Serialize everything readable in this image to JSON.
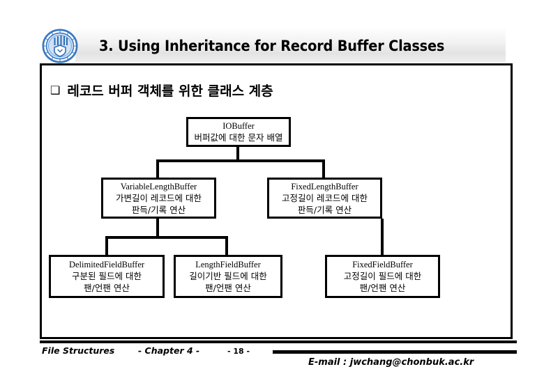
{
  "slide": {
    "title": "3. Using Inheritance for Record Buffer Classes",
    "logo_icon": "university-seal-icon",
    "heading_bullet": "❑",
    "heading": "레코드 버퍼 객체를 위한 클래스 계층"
  },
  "diagram": {
    "type": "class-hierarchy",
    "nodes": [
      {
        "id": "iobuffer",
        "class_name": "IOBuffer",
        "description_lines": [
          "버퍼값에 대한 문자 배열"
        ],
        "level": 1
      },
      {
        "id": "varlen",
        "class_name": "VariableLengthBuffer",
        "description_lines": [
          "가변길이 레코드에 대한",
          "판득/기록 연산"
        ],
        "level": 2,
        "parent": "iobuffer"
      },
      {
        "id": "fixedlen",
        "class_name": "FixedLengthBuffer",
        "description_lines": [
          "고정길이 레코드에 대한",
          "판득/기록 연산"
        ],
        "level": 2,
        "parent": "iobuffer"
      },
      {
        "id": "delimfield",
        "class_name": "DelimitedFieldBuffer",
        "description_lines": [
          "구분된 필드에 대한",
          "팬/언팬 연산"
        ],
        "level": 3,
        "parent": "varlen"
      },
      {
        "id": "lenfield",
        "class_name": "LengthFieldBuffer",
        "description_lines": [
          "길이기반 필드에 대한",
          "팬/언팬 연산"
        ],
        "level": 3,
        "parent": "varlen"
      },
      {
        "id": "fixedfield",
        "class_name": "FixedFieldBuffer",
        "description_lines": [
          "고정길이 필드에 대한",
          "팬/언팬 연산"
        ],
        "level": 3,
        "parent": "fixedlen"
      }
    ]
  },
  "footer": {
    "book": "File Structures",
    "chapter": "- Chapter 4 -",
    "page": "- 18 -",
    "email": "E-mail : jwchang@chonbuk.ac.kr"
  },
  "colors": {
    "ink": "#000000",
    "page": "#ffffff",
    "shadow": "#969696",
    "seal_blue": "#3a78c2",
    "titlebar_top": "#fdfdfd",
    "titlebar_bottom": "#e3e3e3"
  }
}
